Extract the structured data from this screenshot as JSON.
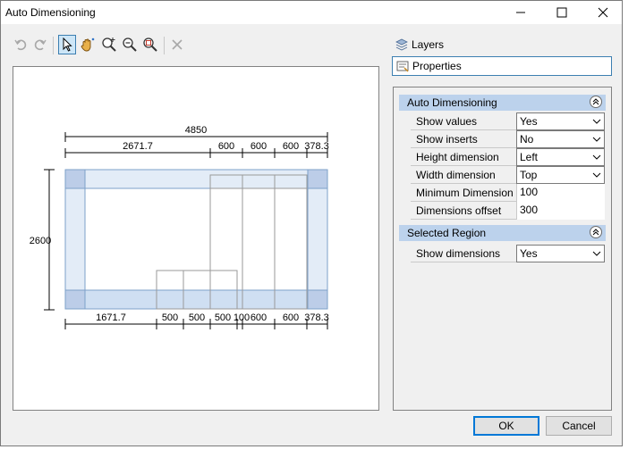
{
  "window": {
    "title": "Auto Dimensioning"
  },
  "toolbar": {
    "tools": [
      "undo-icon",
      "redo-icon",
      "select-pointer-icon",
      "pan-hand-icon",
      "zoom-in-icon",
      "zoom-out-icon",
      "zoom-extents-icon",
      "delete-icon"
    ]
  },
  "side_tabs": {
    "layers": "Layers",
    "properties": "Properties"
  },
  "properties": {
    "auto_dimensioning": {
      "header": "Auto Dimensioning",
      "show_values": {
        "label": "Show values",
        "value": "Yes"
      },
      "show_inserts": {
        "label": "Show inserts",
        "value": "No"
      },
      "height_dimension": {
        "label": "Height dimension",
        "value": "Left"
      },
      "width_dimension": {
        "label": "Width dimension",
        "value": "Top"
      },
      "minimum_dimension": {
        "label": "Minimum Dimension",
        "value": "100"
      },
      "dimensions_offset": {
        "label": "Dimensions offset",
        "value": "300"
      }
    },
    "selected_region": {
      "header": "Selected Region",
      "show_dimensions": {
        "label": "Show dimensions",
        "value": "Yes"
      }
    }
  },
  "drawing": {
    "overall_width": "4850",
    "height": "2600",
    "top_segments": [
      "2671.7",
      "600",
      "600",
      "600",
      "378.3"
    ],
    "bottom_segments": [
      "1671.7",
      "500",
      "500",
      "500",
      "100",
      "600",
      "600",
      "378.3"
    ]
  },
  "buttons": {
    "ok": "OK",
    "cancel": "Cancel"
  },
  "colors": {
    "panel_fill": "#e3ecf7",
    "panel_stroke": "#7ea1c9",
    "category_header": "#bcd2ec",
    "accent": "#0078d7"
  }
}
